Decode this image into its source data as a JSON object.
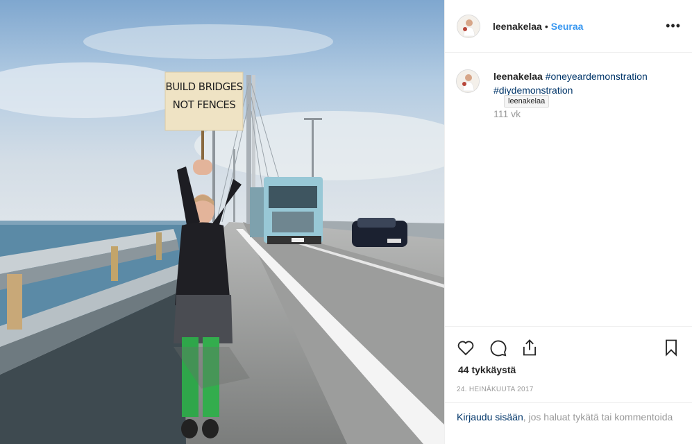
{
  "post": {
    "username": "leenakelaa",
    "follow_label": "Seuraa",
    "separator": "•",
    "more_label": "•••",
    "sign_text": [
      "BUILD BRIDGES",
      "NOT FENCES"
    ]
  },
  "caption": {
    "username": "leenakelaa",
    "hashtag1": "#oneyeardemonstration",
    "hashtag2": "#diydemonstration",
    "tooltip": "leenakelaa",
    "time": "111 vk"
  },
  "actions": {
    "like_icon": "heart-icon",
    "comment_icon": "comment-icon",
    "share_icon": "share-icon",
    "save_icon": "bookmark-icon",
    "likes": "44 tykkäystä",
    "date": "24. HEINÄKUUTA 2017"
  },
  "login": {
    "link": "Kirjaudu sisään",
    "text": ", jos haluat tykätä tai kommentoida"
  },
  "colors": {
    "link_blue": "#3897f0",
    "hashtag": "#003569",
    "muted": "#999999"
  }
}
